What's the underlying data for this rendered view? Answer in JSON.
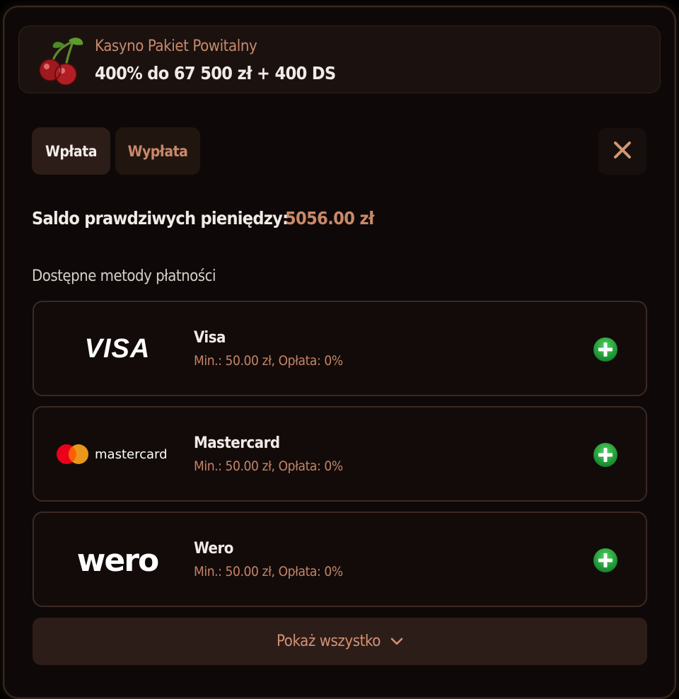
{
  "promo": {
    "subtitle": "Kasyno Pakiet Powitalny",
    "title": "400% do 67 500 zł + 400 DS",
    "icon": "cherries-icon"
  },
  "tabs": [
    {
      "label": "Wpłata",
      "active": true
    },
    {
      "label": "Wypłata",
      "active": false
    }
  ],
  "close_icon": "close-icon",
  "balance": {
    "label": "Saldo prawdziwych pieniędzy:",
    "value": "5056.00 zł"
  },
  "methods_title": "Dostępne metody płatności",
  "methods": [
    {
      "name": "Visa",
      "meta": "Min.: 50.00 zł, Opłata: 0%",
      "logo_text": "VISA"
    },
    {
      "name": "Mastercard",
      "meta": "Min.: 50.00 zł, Opłata: 0%",
      "logo_text": "mastercard"
    },
    {
      "name": "Wero",
      "meta": "Min.: 50.00 zł, Opłata: 0%",
      "logo_text": "wero"
    }
  ],
  "show_all": {
    "label": "Pokaż wszystko",
    "icon": "chevron-down-icon"
  },
  "colors": {
    "accent": "#c8896a",
    "panel": "#120b09",
    "button": "#2d1d18",
    "plus_green": "#1fa53a"
  }
}
